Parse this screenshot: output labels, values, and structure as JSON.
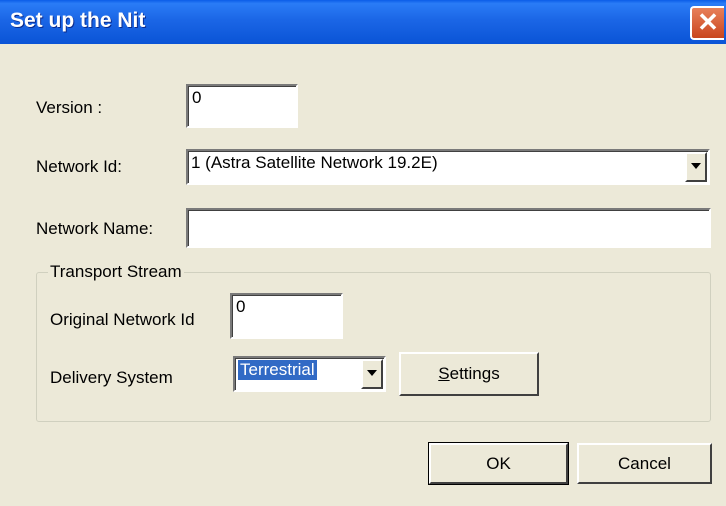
{
  "window": {
    "title": "Set up the Nit",
    "close_glyph": "✕"
  },
  "form": {
    "version_label": "Version :",
    "version_value": "0",
    "network_id_label": "Network Id:",
    "network_id_value": "1 (Astra Satellite Network 19.2E)",
    "network_name_label": "Network Name:",
    "network_name_value": ""
  },
  "transport_stream": {
    "group_label": "Transport Stream",
    "original_network_id_label": "Original Network Id",
    "original_network_id_value": "0",
    "delivery_system_label": "Delivery System",
    "delivery_system_value": "Terrestrial",
    "settings_prefix": "S",
    "settings_rest": "ettings"
  },
  "buttons": {
    "ok": "OK",
    "cancel": "Cancel"
  },
  "colors": {
    "titlebar": "#1b66e6",
    "selection": "#316ac5",
    "dialog_bg": "#ece9d8"
  }
}
